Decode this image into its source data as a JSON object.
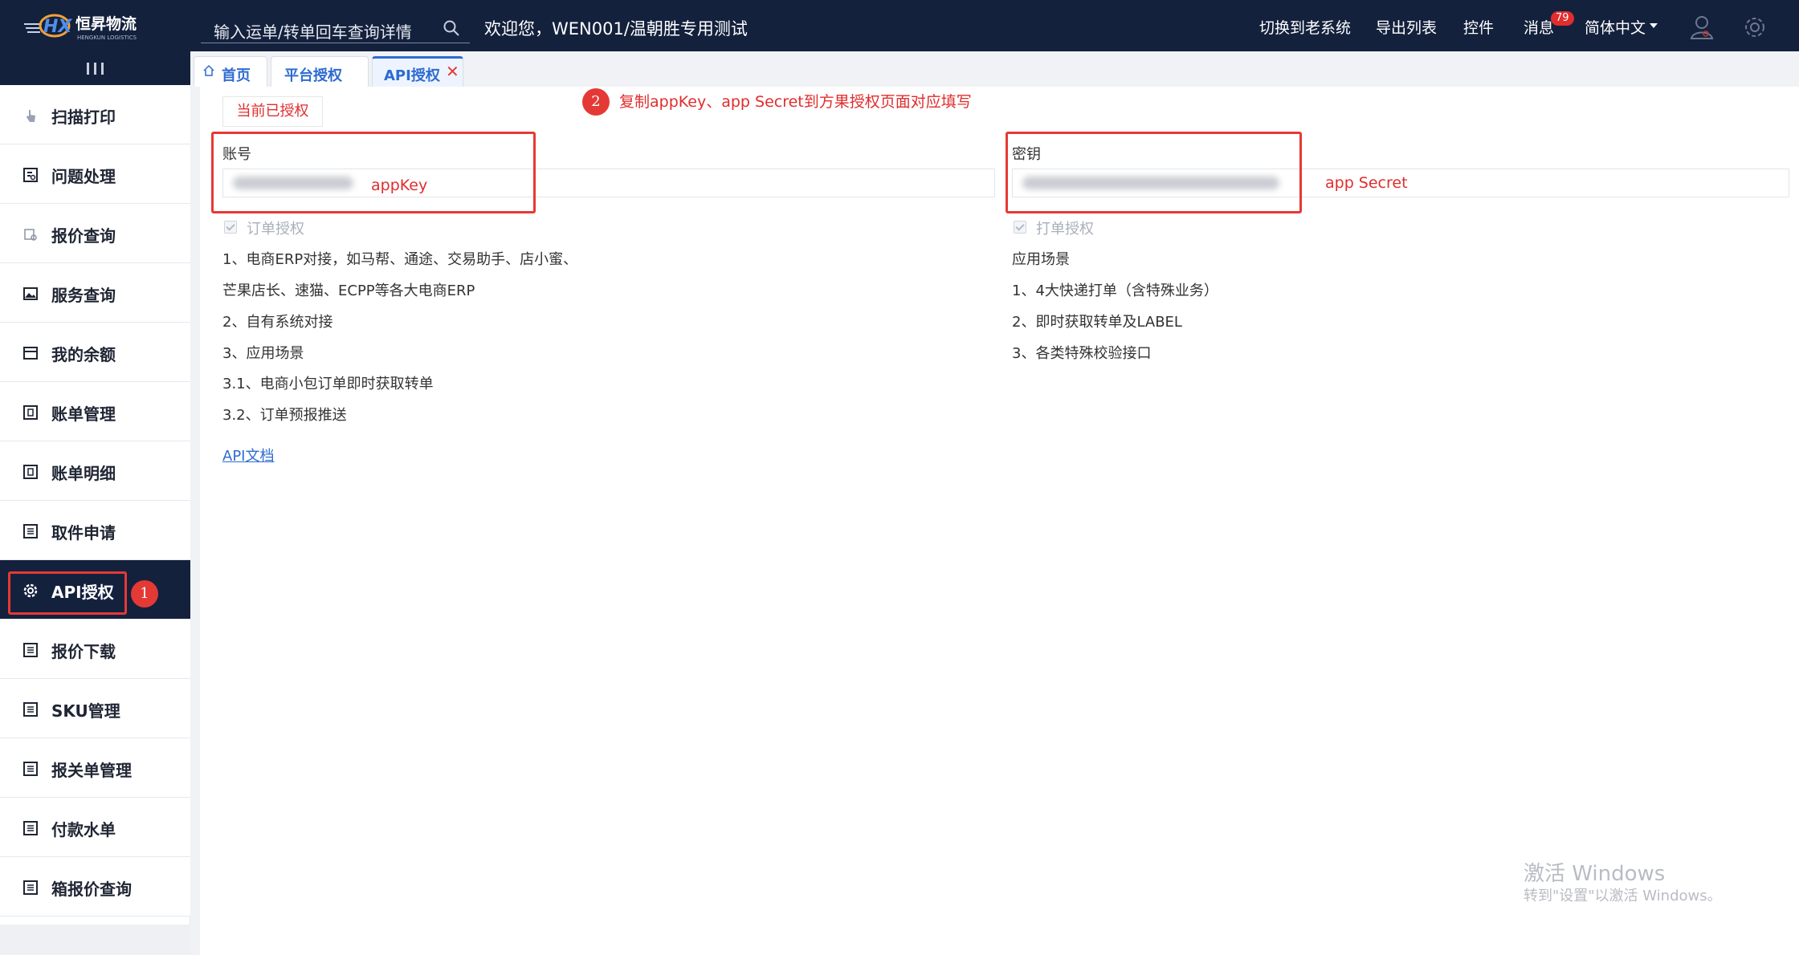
{
  "header": {
    "logo": {
      "mark": "HX",
      "brand": "恒昇物流",
      "sub": "HENGKUN LOGISTICS"
    },
    "search_placeholder": "输入运单/转单回车查询详情",
    "welcome": "欢迎您，WEN001/温朝胜专用测试",
    "nav": {
      "switch_old": "切换到老系统",
      "export_list": "导出列表",
      "controls": "控件",
      "messages": "消息",
      "message_count": "79",
      "language": "简体中文"
    }
  },
  "sidebar": {
    "items": [
      {
        "label": "扫描打印",
        "icon": "hand-pointer-icon"
      },
      {
        "label": "问题处理",
        "icon": "question-doc-icon"
      },
      {
        "label": "报价查询",
        "icon": "price-search-icon"
      },
      {
        "label": "服务查询",
        "icon": "picture-icon"
      },
      {
        "label": "我的余额",
        "icon": "wallet-icon"
      },
      {
        "label": "账单管理",
        "icon": "bill-icon"
      },
      {
        "label": "账单明细",
        "icon": "bill-detail-icon"
      },
      {
        "label": "取件申请",
        "icon": "list-icon"
      },
      {
        "label": "API授权",
        "icon": "gear-icon",
        "active": true
      },
      {
        "label": "报价下载",
        "icon": "list-icon"
      },
      {
        "label": "SKU管理",
        "icon": "list-icon"
      },
      {
        "label": "报关单管理",
        "icon": "list-icon"
      },
      {
        "label": "付款水单",
        "icon": "list-icon"
      },
      {
        "label": "箱报价查询",
        "icon": "list-icon"
      }
    ],
    "callout_number": "1"
  },
  "tabs": [
    {
      "label": "首页",
      "icon": "home-icon"
    },
    {
      "label": "平台授权"
    },
    {
      "label": "API授权",
      "active": true,
      "closable": true
    }
  ],
  "content": {
    "auth_status_button": "当前已授权",
    "callout_number": "2",
    "instruction": "复制appKey、app Secret到方果授权页面对应填写",
    "account": {
      "label": "账号",
      "overlay": "appKey"
    },
    "secret": {
      "label": "密钥",
      "overlay": "app Secret"
    },
    "order_auth": {
      "checkbox_label": "订单授权",
      "checked": true,
      "lines": [
        "1、电商ERP对接，如马帮、通途、交易助手、店小蜜、",
        "芒果店长、速猫、ECPP等各大电商ERP",
        "2、自有系统对接",
        "3、应用场景",
        "3.1、电商小包订单即时获取转单",
        "3.2、订单预报推送"
      ]
    },
    "print_auth": {
      "checkbox_label": "打单授权",
      "checked": true,
      "lines": [
        "应用场景",
        "1、4大快递打单（含特殊业务）",
        "2、即时获取转单及LABEL",
        "3、各类特殊校验接口"
      ]
    },
    "doc_link": "API文档"
  },
  "watermark": {
    "line1": "激活 Windows",
    "line2": "转到\"设置\"以激活 Windows。"
  },
  "colors": {
    "header_bg": "#14213d",
    "accent": "#2e6bd1",
    "annotation_red": "#e53935"
  }
}
